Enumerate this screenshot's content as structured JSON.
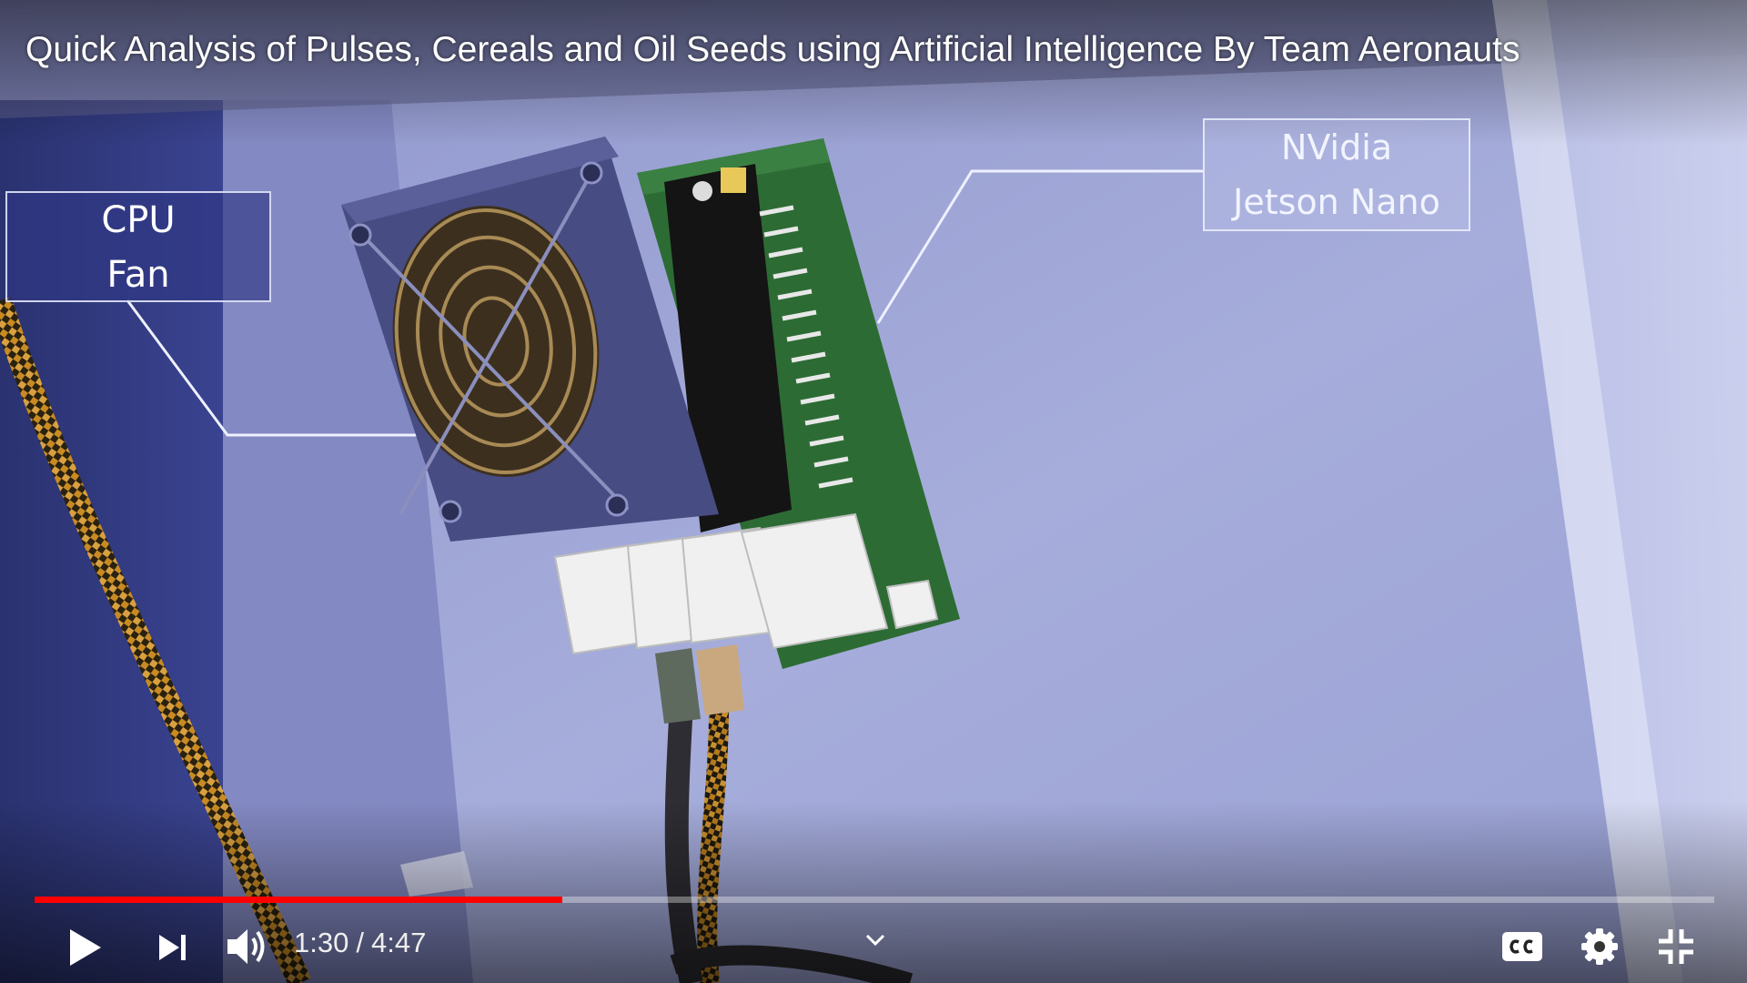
{
  "video": {
    "title": "Quick Analysis of Pulses, Cereals and Oil Seeds using Artificial Intelligence By Team Aeronauts"
  },
  "annotations": {
    "cpu_fan": {
      "line1": "CPU",
      "line2": "Fan"
    },
    "jetson": {
      "line1": "NVidia",
      "line2": "Jetson Nano"
    }
  },
  "player": {
    "current_time": "1:30",
    "separator": "/",
    "duration": "4:47",
    "progress_fraction": 0.314,
    "colors": {
      "progress": "#ff0000",
      "track": "#bdbdbd",
      "controls": "#ffffff"
    }
  },
  "icons": {
    "play": "play-icon",
    "next": "next-icon",
    "volume": "volume-icon",
    "chevron": "chevron-down-icon",
    "captions": "captions-icon",
    "settings": "gear-icon",
    "exit_fullscreen": "exit-fullscreen-icon"
  }
}
